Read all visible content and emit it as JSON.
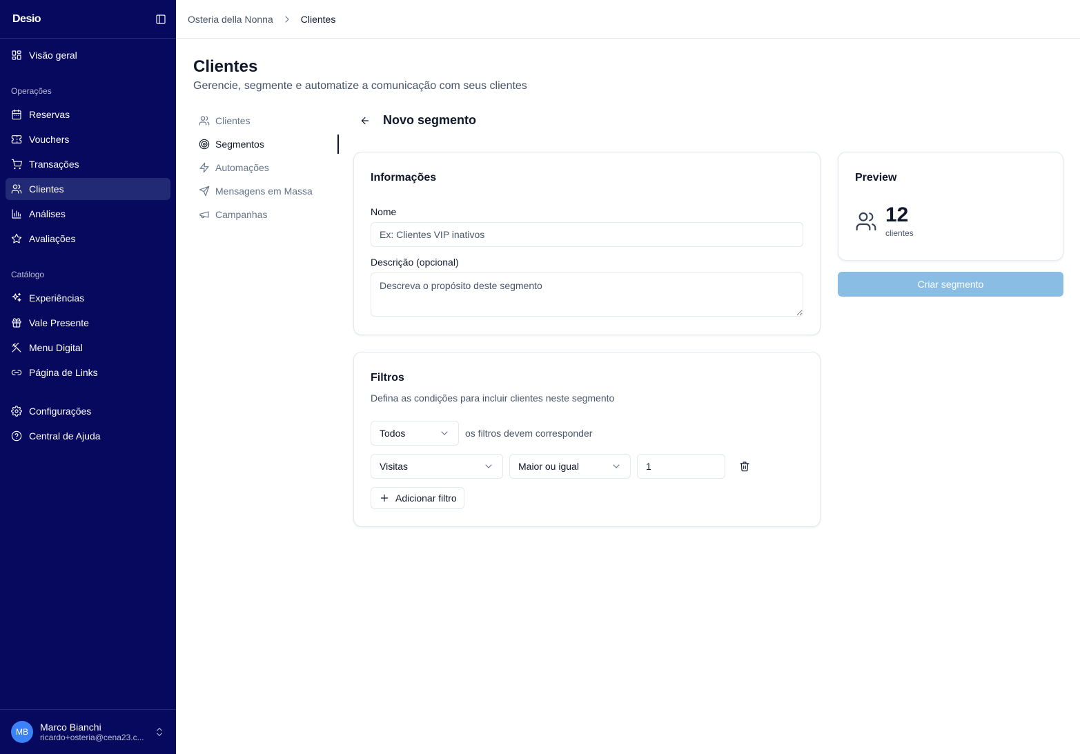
{
  "sidebar": {
    "logo": "Desio",
    "overview": "Visão geral",
    "groups": [
      {
        "label": "Operações",
        "items": [
          {
            "label": "Reservas",
            "icon": "calendar-icon"
          },
          {
            "label": "Vouchers",
            "icon": "ticket-icon"
          },
          {
            "label": "Transações",
            "icon": "cart-icon"
          },
          {
            "label": "Clientes",
            "icon": "users-icon",
            "active": true
          },
          {
            "label": "Análises",
            "icon": "bar-chart-icon"
          },
          {
            "label": "Avaliações",
            "icon": "star-icon"
          }
        ]
      },
      {
        "label": "Catálogo",
        "items": [
          {
            "label": "Experiências",
            "icon": "sparkles-icon"
          },
          {
            "label": "Vale Presente",
            "icon": "gift-icon"
          },
          {
            "label": "Menu Digital",
            "icon": "utensils-icon"
          },
          {
            "label": "Página de Links",
            "icon": "link-icon"
          }
        ]
      }
    ],
    "bottom_items": [
      {
        "label": "Configurações",
        "icon": "gear-icon"
      },
      {
        "label": "Central de Ajuda",
        "icon": "help-circle-icon"
      }
    ],
    "user": {
      "initials": "MB",
      "name": "Marco Bianchi",
      "email": "ricardo+osteria@cena23.c..."
    }
  },
  "breadcrumb": {
    "parent": "Osteria della Nonna",
    "current": "Clientes"
  },
  "page": {
    "title": "Clientes",
    "subtitle": "Gerencie, segmente e automatize a comunicação com seus clientes"
  },
  "subnav": [
    {
      "label": "Clientes",
      "icon": "users-icon"
    },
    {
      "label": "Segmentos",
      "icon": "target-icon",
      "active": true
    },
    {
      "label": "Automações",
      "icon": "zap-icon"
    },
    {
      "label": "Mensagens em Massa",
      "icon": "send-icon"
    },
    {
      "label": "Campanhas",
      "icon": "megaphone-icon"
    }
  ],
  "segment": {
    "heading": "Novo segmento",
    "info": {
      "title": "Informações",
      "name_label": "Nome",
      "name_placeholder": "Ex: Clientes VIP inativos",
      "desc_label": "Descrição (opcional)",
      "desc_placeholder": "Descreva o propósito deste segmento"
    },
    "filters": {
      "title": "Filtros",
      "description": "Defina as condições para incluir clientes neste segmento",
      "match_value": "Todos",
      "match_text": "os filtros devem corresponder",
      "rules": [
        {
          "field": "Visitas",
          "operator": "Maior ou igual",
          "value": "1"
        }
      ],
      "add_label": "Adicionar filtro"
    },
    "preview": {
      "title": "Preview",
      "count": "12",
      "unit": "clientes"
    },
    "create_label": "Criar segmento"
  },
  "colors": {
    "sidebar_bg": "#06095e",
    "sidebar_active": "#232a75",
    "create_button_disabled": "#89bde3",
    "avatar": "#3b82f6"
  }
}
